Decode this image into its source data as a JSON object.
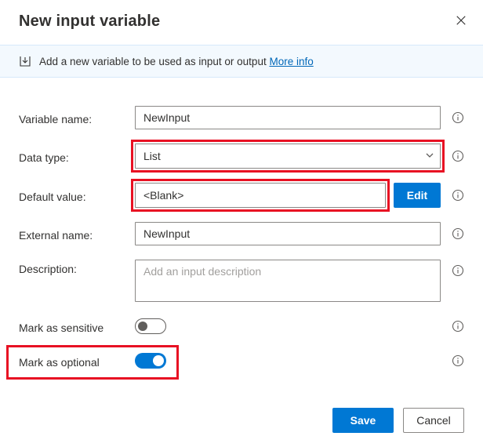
{
  "dialog": {
    "title": "New input variable"
  },
  "banner": {
    "text": "Add a new variable to be used as input or output",
    "link": "More info"
  },
  "labels": {
    "variable_name": "Variable name:",
    "data_type": "Data type:",
    "default_value": "Default value:",
    "external_name": "External name:",
    "description": "Description:",
    "mark_sensitive": "Mark as sensitive",
    "mark_optional": "Mark as optional"
  },
  "values": {
    "variable_name": "NewInput",
    "data_type": "List",
    "default_value": "<Blank>",
    "external_name": "NewInput",
    "description": "",
    "description_placeholder": "Add an input description",
    "sensitive": false,
    "optional": true
  },
  "buttons": {
    "edit": "Edit",
    "save": "Save",
    "cancel": "Cancel"
  },
  "colors": {
    "accent": "#0078d4",
    "highlight": "#e81123",
    "banner_bg": "#f3f9fe"
  }
}
